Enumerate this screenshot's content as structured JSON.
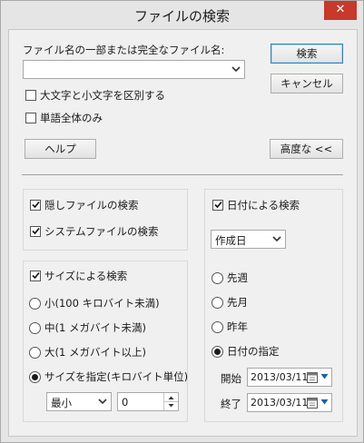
{
  "window": {
    "title": "ファイルの検索",
    "close_glyph": "✕"
  },
  "search": {
    "name_label": "ファイル名の一部または完全なファイル名:",
    "name_value": "",
    "case_sensitive_label": "大文字と小文字を区別する",
    "case_sensitive_checked": false,
    "whole_word_label": "単語全体のみ",
    "whole_word_checked": false
  },
  "buttons": {
    "search": "検索",
    "cancel": "キャンセル",
    "help": "ヘルプ",
    "advanced": "高度な <<"
  },
  "attributes": {
    "hidden_label": "隠しファイルの検索",
    "hidden_checked": true,
    "system_label": "システムファイルの検索",
    "system_checked": true
  },
  "size": {
    "enable_label": "サイズによる検索",
    "enable_checked": true,
    "options": [
      {
        "label": "小(100 キロバイト未満)",
        "selected": false
      },
      {
        "label": "中(1 メガバイト未満)",
        "selected": false
      },
      {
        "label": "大(1 メガバイト以上)",
        "selected": false
      },
      {
        "label": "サイズを指定(キロバイト単位)",
        "selected": true
      }
    ],
    "mode_value": "最小",
    "amount_value": "0"
  },
  "date": {
    "enable_label": "日付による検索",
    "enable_checked": true,
    "type_value": "作成日",
    "options": [
      {
        "label": "先週",
        "selected": false
      },
      {
        "label": "先月",
        "selected": false
      },
      {
        "label": "昨年",
        "selected": false
      },
      {
        "label": "日付の指定",
        "selected": true
      }
    ],
    "start_label": "開始",
    "start_value": "2013/03/11",
    "end_label": "終了",
    "end_value": "2013/03/11"
  }
}
